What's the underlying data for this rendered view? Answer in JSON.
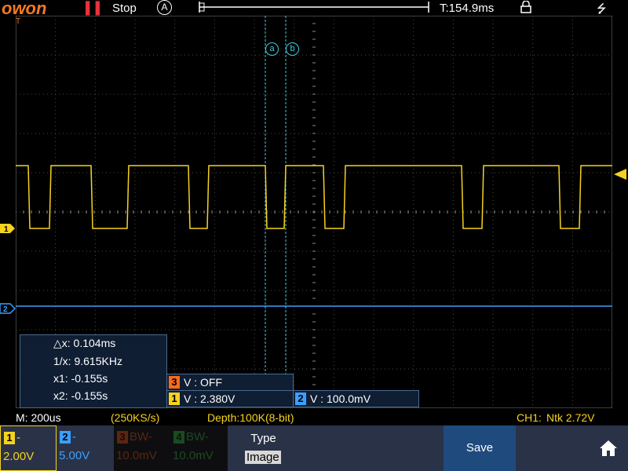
{
  "header": {
    "brand": "owon",
    "run_state_icon": "pause-icon",
    "run_state": "Stop",
    "trigger_mode": "A",
    "trigger_time": "T:154.9ms",
    "lock_icon": "lock-icon",
    "usb_icon": "usb-icon"
  },
  "cursors": {
    "a": "a",
    "b": "b"
  },
  "measurements": {
    "dx": "△x: 0.104ms",
    "inv_x": "1/x: 9.615KHz",
    "x1": "x1: -0.155s",
    "x2": "x2: -0.155s"
  },
  "channel_readouts": {
    "ch3": {
      "num": "3",
      "text": "V : OFF"
    },
    "ch1": {
      "num": "1",
      "text": "V : 2.380V"
    },
    "ch2": {
      "num": "2",
      "text": "V : 100.0mV"
    }
  },
  "markers": {
    "ch1": "1",
    "ch2": "2",
    "trigger_edge": "T"
  },
  "status": {
    "timebase": "M: 200us",
    "sample_rate": "(250KS/s)",
    "depth": "Depth:100K(8-bit)",
    "trigger_source": "CH1:",
    "trigger_info": "Ntk 2.72V"
  },
  "bottom_menu": {
    "ch1": {
      "num": "1",
      "coupling": "-",
      "scale": "2.00V"
    },
    "ch2": {
      "num": "2",
      "coupling": "-",
      "scale": "5.00V"
    },
    "ch3": {
      "num": "3",
      "coupling": "BW-",
      "scale": "10.0mV"
    },
    "ch4": {
      "num": "4",
      "coupling": "BW-",
      "scale": "10.0mV"
    },
    "type_label": "Type",
    "type_value": "Image",
    "save_label": "Save",
    "home_icon": "home-icon"
  },
  "colors": {
    "ch1": "#f5d21e",
    "ch2": "#3aa0ff",
    "ch3": "#ff6a1a",
    "ch4": "#22aa44",
    "cursor": "#3fd0e0",
    "brand": "#f47a20"
  }
}
